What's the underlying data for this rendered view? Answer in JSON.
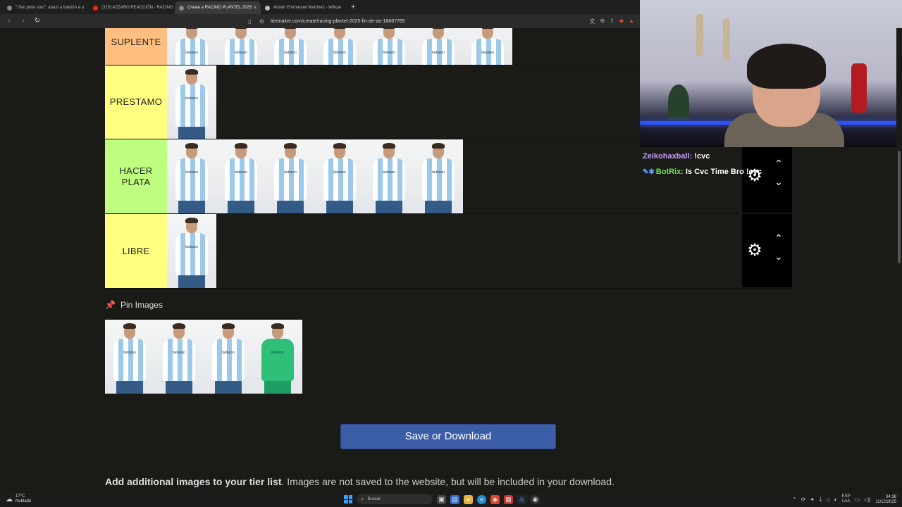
{
  "browser": {
    "tabs": [
      {
        "label": "\"¡Tan piola sos!\": atacó a traición a u",
        "color": "#888"
      },
      {
        "label": "(315) AZZARO REACCIÓN - RACING",
        "color": "#ff2020"
      },
      {
        "label": "Create a RACING PLANTEL 2025",
        "color": "#888"
      },
      {
        "label": "Adrián Emmanuel Martínez - Wikipe",
        "color": "#bbbbbb"
      }
    ],
    "active_tab_close": "×",
    "new_tab": "+",
    "url": "tiermaker.com/create/racing-plantel-2025-fin-de-ao-18887765"
  },
  "tiers": [
    {
      "label": "SUPLENTE",
      "color": "#ffbf80",
      "players": 7
    },
    {
      "label": "PRESTAMO",
      "color": "#ffff7f",
      "players": 1
    },
    {
      "label": "HACER PLATA",
      "color": "#bfff7f",
      "players": 6
    },
    {
      "label": "LIBRE",
      "color": "#ffff7f",
      "players": 1
    }
  ],
  "sponsor_text": "betsson",
  "pin": {
    "title": "Pin Images",
    "players": [
      "field",
      "field",
      "field",
      "goalkeeper"
    ]
  },
  "save_button": "Save or Download",
  "add_images": {
    "bold": "Add additional images to your tier list",
    "rest": ". Images are not saved to the website, but will be included in your download."
  },
  "chat": [
    {
      "user": "Zeikohaxball:",
      "msg": " !cvc",
      "badges": false
    },
    {
      "user": "BotRix:",
      "msg": " Is Cvc Time Bro !cvc",
      "badges": true
    }
  ],
  "taskbar": {
    "temp": "17°C",
    "weather": "Nublado",
    "search": "Buscar",
    "lang1": "ESP",
    "lang2": "LAA",
    "time": "04:38",
    "date": "11/12/2025"
  }
}
